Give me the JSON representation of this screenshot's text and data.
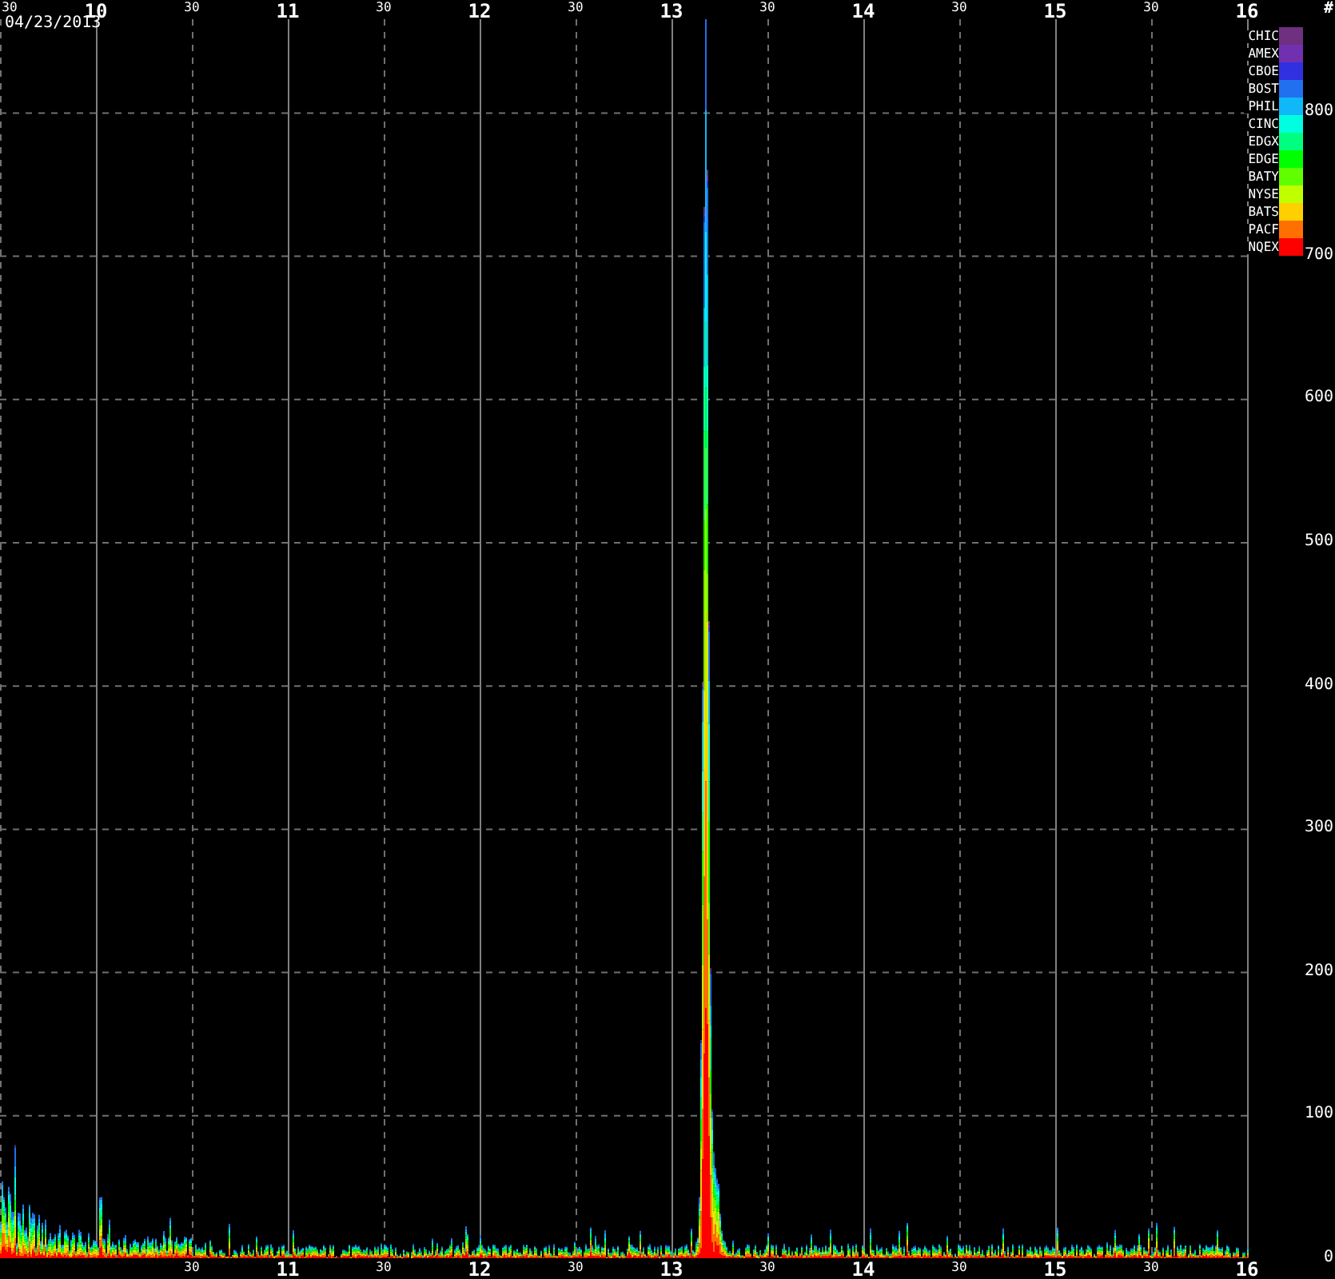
{
  "date": "04/23/2013",
  "y_unit": "#",
  "top_axis": [
    {
      "label": "30",
      "kind": "half"
    },
    {
      "label": "10",
      "kind": "hour"
    },
    {
      "label": "30",
      "kind": "half"
    },
    {
      "label": "11",
      "kind": "hour"
    },
    {
      "label": "30",
      "kind": "half"
    },
    {
      "label": "12",
      "kind": "hour"
    },
    {
      "label": "30",
      "kind": "half"
    },
    {
      "label": "13",
      "kind": "hour"
    },
    {
      "label": "30",
      "kind": "half"
    },
    {
      "label": "14",
      "kind": "hour"
    },
    {
      "label": "30",
      "kind": "half"
    },
    {
      "label": "15",
      "kind": "hour"
    },
    {
      "label": "30",
      "kind": "half"
    },
    {
      "label": "16",
      "kind": "hour"
    }
  ],
  "bottom_axis": [
    {
      "label": "30",
      "kind": "half"
    },
    {
      "label": "11",
      "kind": "hour"
    },
    {
      "label": "30",
      "kind": "half"
    },
    {
      "label": "12",
      "kind": "hour"
    },
    {
      "label": "30",
      "kind": "half"
    },
    {
      "label": "13",
      "kind": "hour"
    },
    {
      "label": "30",
      "kind": "half"
    },
    {
      "label": "14",
      "kind": "hour"
    },
    {
      "label": "30",
      "kind": "half"
    },
    {
      "label": "15",
      "kind": "hour"
    },
    {
      "label": "30",
      "kind": "half"
    },
    {
      "label": "16",
      "kind": "hour"
    }
  ],
  "y_axis": [
    "800",
    "700",
    "600",
    "500",
    "400",
    "300",
    "200",
    "100",
    "0"
  ],
  "legend": [
    {
      "label": "CHIC",
      "color": "#6f3080"
    },
    {
      "label": "AMEX",
      "color": "#7030b0"
    },
    {
      "label": "CBOE",
      "color": "#3030e0"
    },
    {
      "label": "BOST",
      "color": "#2070f0"
    },
    {
      "label": "PHIL",
      "color": "#10b8f8"
    },
    {
      "label": "CINC",
      "color": "#00ffe0"
    },
    {
      "label": "EDGX",
      "color": "#00ff80"
    },
    {
      "label": "EDGE",
      "color": "#00ff00"
    },
    {
      "label": "BATY",
      "color": "#60ff00"
    },
    {
      "label": "NYSE",
      "color": "#c0ff00"
    },
    {
      "label": "BATS",
      "color": "#ffd000"
    },
    {
      "label": "PACF",
      "color": "#ff7000"
    },
    {
      "label": "NQEX",
      "color": "#ff0000"
    }
  ]
}
